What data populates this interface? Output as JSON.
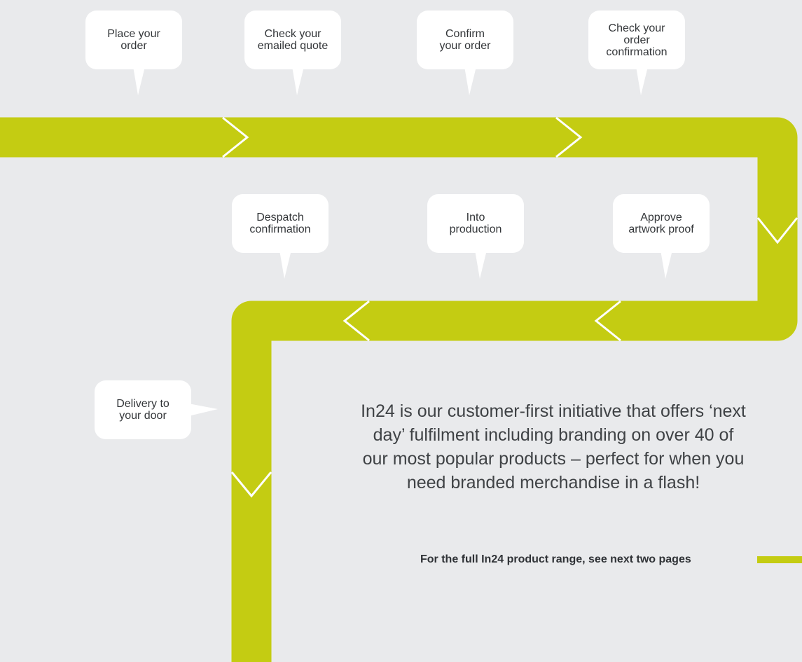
{
  "steps_top": [
    {
      "lines": [
        "Place your",
        "order"
      ]
    },
    {
      "lines": [
        "Check your",
        "emailed quote"
      ]
    },
    {
      "lines": [
        "Confirm",
        "your order"
      ]
    },
    {
      "lines": [
        "Check your",
        "order",
        "confirmation"
      ]
    }
  ],
  "steps_middle": [
    {
      "lines": [
        "Despatch",
        "confirmation"
      ]
    },
    {
      "lines": [
        "Into",
        "production"
      ]
    },
    {
      "lines": [
        "Approve",
        "artwork proof"
      ]
    }
  ],
  "step_final": {
    "lines": [
      "Delivery to",
      "your door"
    ]
  },
  "intro": {
    "lines": [
      "In24 is our customer-first initiative that offers ‘next",
      "day’ fulfilment including branding on over 40 of",
      "our most popular products – perfect for when you",
      "need branded merchandise in a flash!"
    ]
  },
  "range_note": "For the full In24 product range, see next two pages",
  "colors": {
    "accent": "#c4cc12",
    "background": "#e9eaec",
    "bubble": "#ffffff",
    "text": "#333639"
  }
}
